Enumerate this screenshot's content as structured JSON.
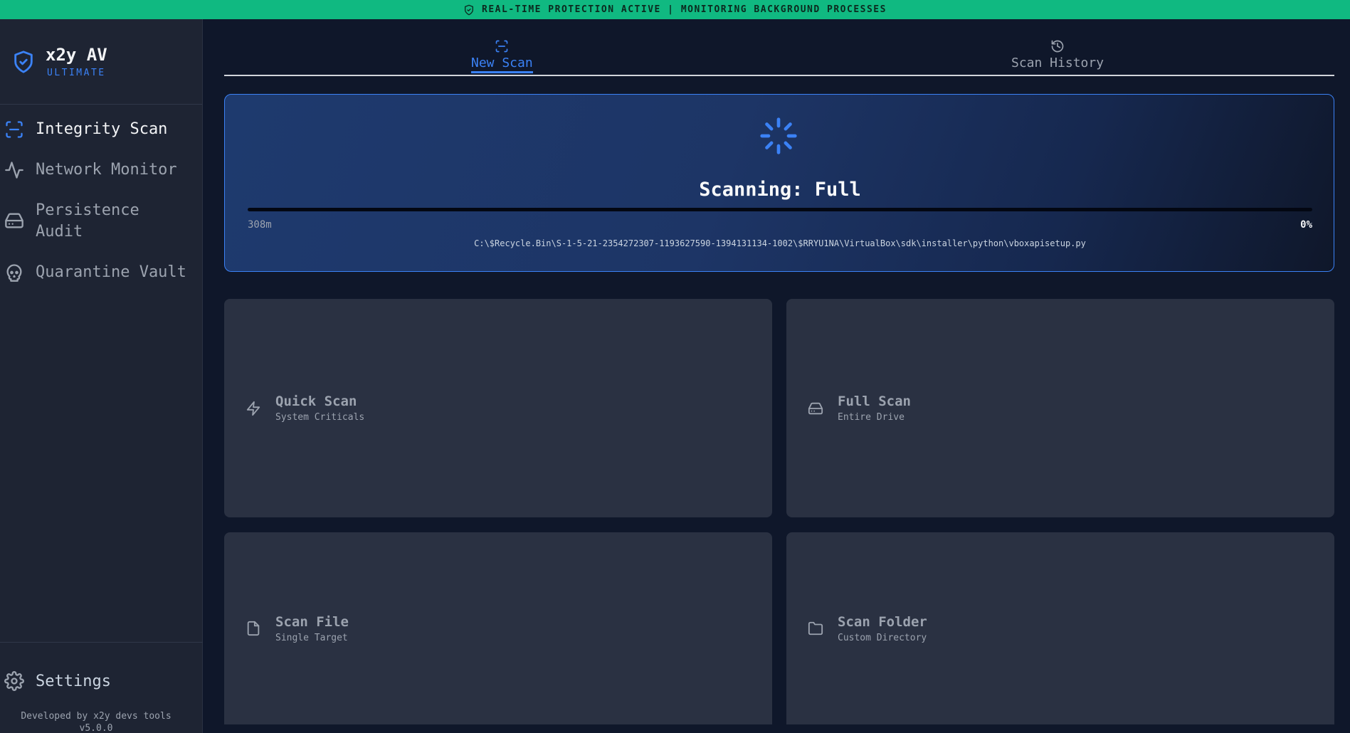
{
  "banner": {
    "text": "REAL-TIME PROTECTION ACTIVE | MONITORING BACKGROUND PROCESSES",
    "color": "#10b981"
  },
  "brand": {
    "name": "x2y AV",
    "edition": "ULTIMATE"
  },
  "sidebar": {
    "items": [
      {
        "label": "Integrity Scan",
        "icon": "scan-icon",
        "active": true
      },
      {
        "label": "Network Monitor",
        "icon": "activity-icon",
        "active": false
      },
      {
        "label": "Persistence Audit",
        "icon": "hard-drive-icon",
        "active": false
      },
      {
        "label": "Quarantine Vault",
        "icon": "skull-icon",
        "active": false
      }
    ],
    "settings_label": "Settings",
    "footer_line1": "Developed by x2y devs tools",
    "footer_line2": "v5.0.0"
  },
  "tabs": [
    {
      "label": "New Scan",
      "icon": "scan-icon",
      "active": true
    },
    {
      "label": "Scan History",
      "icon": "history-icon",
      "active": false
    }
  ],
  "scan": {
    "title": "Scanning: Full",
    "elapsed": "308m",
    "percent_label": "0%",
    "progress": 0,
    "current_path": "C:\\$Recycle.Bin\\S-1-5-21-2354272307-1193627590-1394131134-1002\\$RRYU1NA\\VirtualBox\\sdk\\installer\\python\\vboxapisetup.py"
  },
  "options": [
    {
      "title": "Quick Scan",
      "subtitle": "System Criticals",
      "icon": "zap-icon"
    },
    {
      "title": "Full Scan",
      "subtitle": "Entire Drive",
      "icon": "hard-drive-icon"
    },
    {
      "title": "Scan File",
      "subtitle": "Single Target",
      "icon": "file-icon"
    },
    {
      "title": "Scan Folder",
      "subtitle": "Custom Directory",
      "icon": "folder-icon"
    }
  ],
  "colors": {
    "accent": "#3b82f6",
    "sidebar": "#1e2433",
    "card": "#2a3142",
    "background": "#0f172a"
  }
}
